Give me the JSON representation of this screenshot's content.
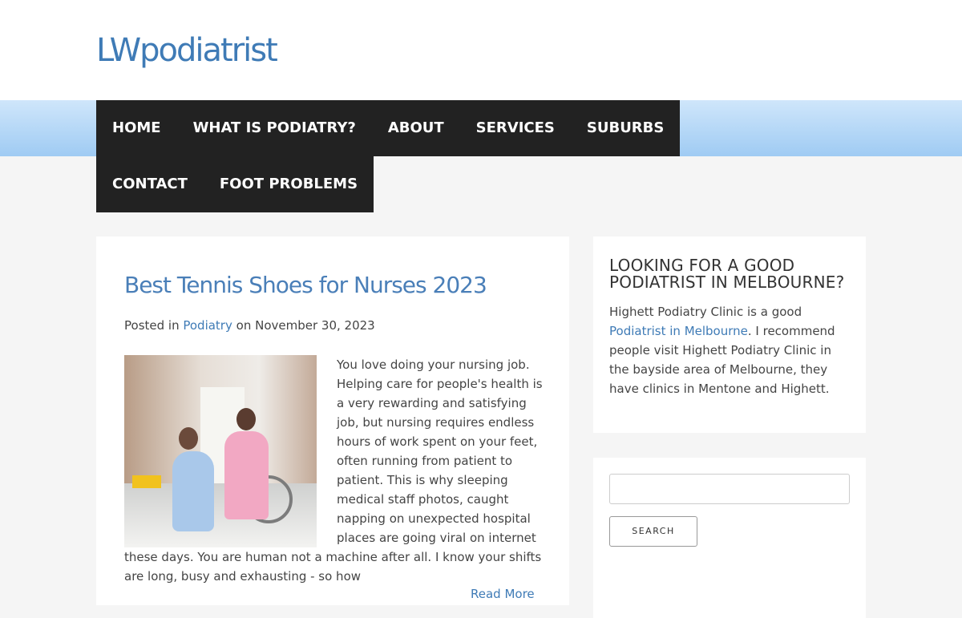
{
  "site": {
    "title": "LWpodiatrist"
  },
  "nav": {
    "items": [
      {
        "label": "HOME"
      },
      {
        "label": "WHAT IS PODIATRY?"
      },
      {
        "label": "ABOUT"
      },
      {
        "label": "SERVICES"
      },
      {
        "label": "SUBURBS"
      },
      {
        "label": "CONTACT"
      },
      {
        "label": "FOOT PROBLEMS"
      }
    ]
  },
  "post": {
    "title": "Best Tennis Shoes for Nurses 2023",
    "meta": {
      "posted_in": "Posted in",
      "category": "Podiatry",
      "on": "on",
      "date": "November 30, 2023"
    },
    "excerpt": "You love doing your nursing job. Helping care for people's health is a very rewarding and satisfying job, but nursing requires endless hours of work spent on your feet, often running from patient to patient. This is why sleeping medical staff photos, caught napping on unexpected hospital places are going viral on internet these days. You are human not a machine after all. I know your shifts are long, busy and exhausting - so how",
    "read_more": "Read More",
    "image_icon": "nurse-with-patient-photo"
  },
  "sidebar": {
    "widget1": {
      "title": "LOOKING FOR A GOOD PODIATRIST IN MELBOURNE?",
      "text_before": "Highett Podiatry Clinic is a good",
      "link": "Podiatrist in Melbourne",
      "text_after": ". I recommend people visit Highett Podiatry Clinic in the bayside area of Melbourne, they have clinics in Mentone and Highett."
    },
    "search": {
      "value": "",
      "button_label": "SEARCH"
    }
  },
  "colors": {
    "accent": "#3f7bb6",
    "nav_bg": "#222222",
    "nav_band": "#9fcbf3"
  }
}
